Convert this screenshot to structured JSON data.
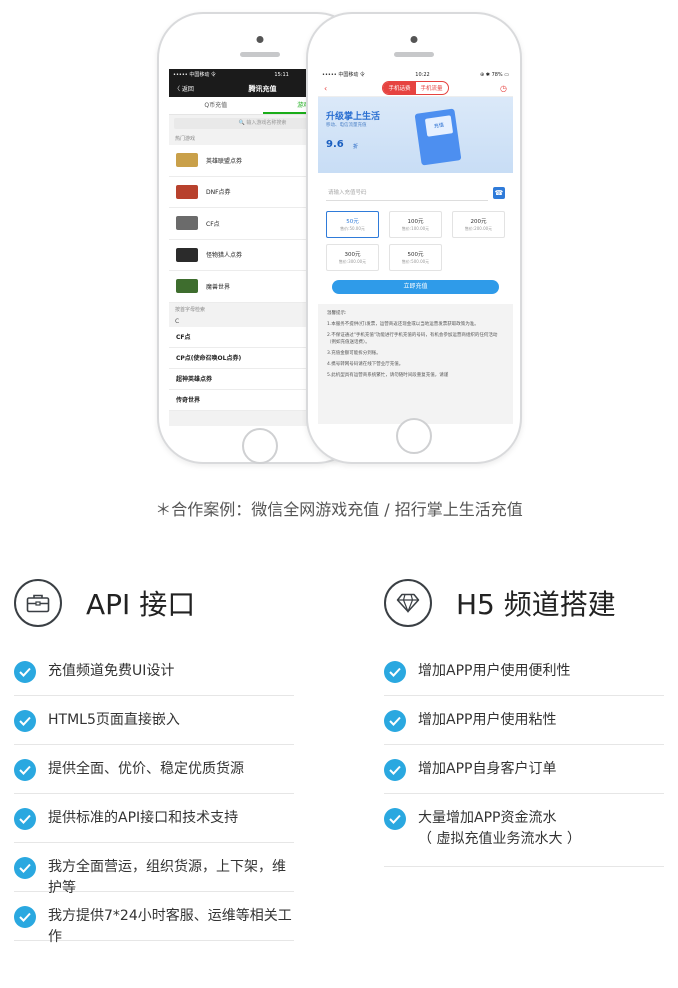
{
  "left_phone": {
    "status_carrier": "••••• 中国移动 令",
    "status_time": "15:11",
    "back_label": "〈 返回",
    "title": "腾讯充值",
    "tabs": [
      "Q币充值",
      "游戏充值"
    ],
    "search_placeholder": "🔍 输入游戏名称搜索",
    "hot_label": "热门游戏",
    "hot_games": [
      {
        "name": "英雄联盟点券",
        "color": "#c9a04a"
      },
      {
        "name": "DNF点券",
        "color": "#b8412d"
      },
      {
        "name": "CF点",
        "color": "#6b6b6b"
      },
      {
        "name": "怪物猎人点券",
        "color": "#2b2b2b"
      },
      {
        "name": "魔兽世界",
        "color": "#3e6d2e"
      }
    ],
    "index_label": "按首字母检索",
    "letter": "C",
    "letter_items": [
      "CF点",
      "CP点(使命召唤OL点券)",
      "超神英雄点券",
      "传奇世界"
    ]
  },
  "right_phone": {
    "status_carrier": "••••• 中国移动 令",
    "status_time": "10:22",
    "status_battery": "⊕ ✱ 78% ▭",
    "seg_left": "手机话费",
    "seg_right": "手机流量",
    "banner_title": "升级掌上生活",
    "banner_sub": "移动、电信流量充值",
    "banner_discount": "9.6",
    "banner_discount_unit": "折",
    "banner_tag": "充值",
    "input_placeholder": "请输入充值号码",
    "amounts": [
      {
        "amount": "50元",
        "price": "售价:50.00元"
      },
      {
        "amount": "100元",
        "price": "售价:100.00元"
      },
      {
        "amount": "200元",
        "price": "售价:200.00元"
      },
      {
        "amount": "300元",
        "price": "售价:300.00元"
      },
      {
        "amount": "500元",
        "price": "售价:500.00元"
      }
    ],
    "button": "立即充值",
    "tips_title": "温馨提示:",
    "tips": [
      "1.本服务不提供(打)发票，运营商返还现金或以当地运营发票获取政策为准。",
      "2.不保证通过\"手机充值\"功能进行手机充值的号码，有机会参加运营商组织的任何活动（例如充值送话费）。",
      "3.充值金额可能拆分到账。",
      "4.携号转网号码请在线下营业厅充值。",
      "5.此机型具有运营商系统繁忙，请勿随时间段重复充值，请谨"
    ]
  },
  "caption": "＊合作案例：微信全网游戏充值 / 招行掌上生活充值",
  "api": {
    "title": "API 接口",
    "icon": "briefcase-icon",
    "features": [
      "充值频道免费UI设计",
      "HTML5页面直接嵌入",
      "提供全面、优价、稳定优质货源",
      "提供标准的API接口和技术支持",
      "我方全面营运，组织货源，上下架，维护等",
      "我方提供7*24小时客服、运维等相关工作"
    ]
  },
  "h5": {
    "title": "H5 频道搭建",
    "icon": "diamond-icon",
    "features": [
      "增加APP用户使用便利性",
      "增加APP用户使用粘性",
      "增加APP自身客户订单",
      "大量增加APP资金流水"
    ],
    "last_sub": "（ 虚拟充值业务流水大 ）"
  },
  "colors": {
    "check": "#2aa8e0",
    "accent_red": "#e64340",
    "wechat_green": "#1aad19"
  }
}
